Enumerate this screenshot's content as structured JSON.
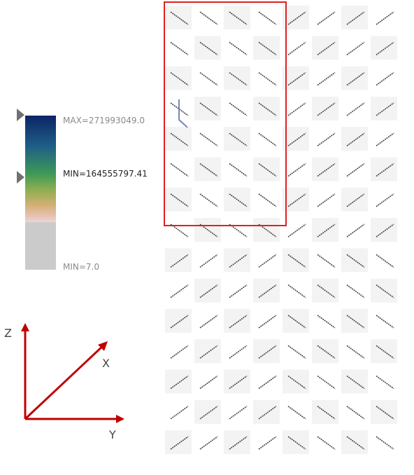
{
  "legend": {
    "max_label": "MAX=271993049.0",
    "min_selected_label": "MIN=164555797.41",
    "min_label": "MIN=7.0",
    "gradient_colors": [
      "#0c2466",
      "#1e5f86",
      "#3f9a56",
      "#8dae52",
      "#d2b072",
      "#e8c4bc",
      "#f0d6d0"
    ],
    "out_of_range_color": "#cbcbcb"
  },
  "axes": {
    "z_label": "Z",
    "x_label": "X",
    "y_label": "Y",
    "axis_color": "#c00000"
  },
  "grid": {
    "rows": 14,
    "cols": 8,
    "cell_color_a": "#f3f3f3",
    "cell_color_b": "#ffffff",
    "line_color": "#444444",
    "orientations": [
      [
        "back",
        "back",
        "back",
        "back",
        "fwd",
        "fwd",
        "fwd",
        "fwd"
      ],
      [
        "back",
        "back",
        "back",
        "back",
        "fwd",
        "fwd",
        "fwd",
        "fwd"
      ],
      [
        "back",
        "back",
        "back",
        "back",
        "fwd",
        "fwd",
        "fwd",
        "fwd"
      ],
      [
        "back",
        "back",
        "back",
        "back",
        "fwd",
        "fwd",
        "fwd",
        "fwd"
      ],
      [
        "back",
        "back",
        "back",
        "back",
        "fwd",
        "fwd",
        "fwd",
        "fwd"
      ],
      [
        "back",
        "back",
        "back",
        "back",
        "fwd",
        "fwd",
        "fwd",
        "fwd"
      ],
      [
        "back",
        "back",
        "back",
        "back",
        "fwd",
        "fwd",
        "fwd",
        "fwd"
      ],
      [
        "back",
        "back",
        "back",
        "back",
        "fwd",
        "fwd",
        "fwd",
        "fwd"
      ],
      [
        "fwd",
        "fwd",
        "fwd",
        "fwd",
        "back",
        "back",
        "back",
        "back"
      ],
      [
        "fwd",
        "fwd",
        "fwd",
        "fwd",
        "back",
        "back",
        "back",
        "back"
      ],
      [
        "fwd",
        "fwd",
        "fwd",
        "fwd",
        "back",
        "back",
        "back",
        "back"
      ],
      [
        "fwd",
        "fwd",
        "fwd",
        "fwd",
        "back",
        "back",
        "back",
        "back"
      ],
      [
        "fwd",
        "fwd",
        "fwd",
        "fwd",
        "back",
        "back",
        "back",
        "back"
      ],
      [
        "fwd",
        "fwd",
        "fwd",
        "fwd",
        "back",
        "back",
        "back",
        "back"
      ],
      [
        "fwd",
        "fwd",
        "fwd",
        "fwd",
        "back",
        "back",
        "back",
        "back"
      ]
    ],
    "selection_color": "#e02020",
    "highlight_color": "#7a86b8"
  }
}
